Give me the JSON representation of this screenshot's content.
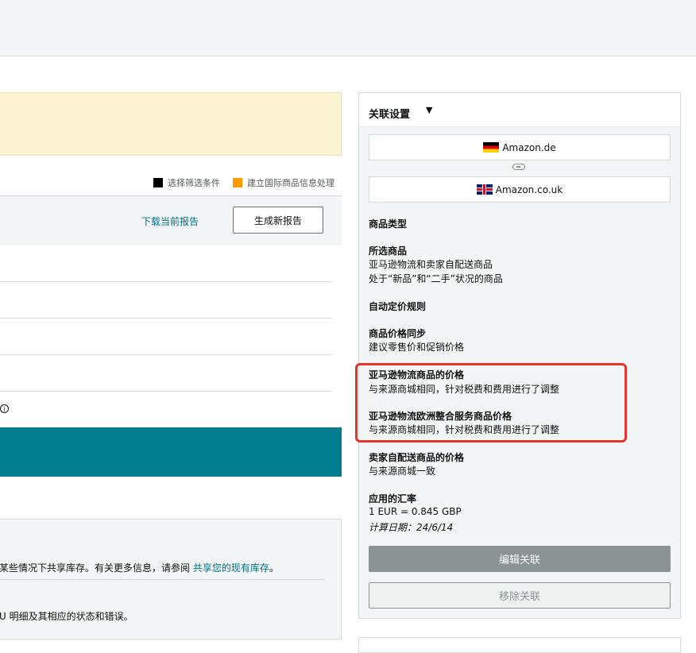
{
  "legend": {
    "item1": "选择筛选条件",
    "item1_color": "#000000",
    "item2": "建立国际商品信息处理",
    "item2_color": "#ff9900"
  },
  "report_toolbar": {
    "download_link": "下载当前报告",
    "generate_button": "生成新报告"
  },
  "bottom_panel": {
    "line1_text": "某些情况下共享库存。有关更多信息，请参阅 ",
    "line1_link": "共享您的现有库存",
    "line1_end": "。",
    "line2_text": "U 明细及其相应的状态和错误。"
  },
  "sidebar": {
    "title": "关联设置",
    "marketplaces": [
      {
        "name": "Amazon.de",
        "flag": "de"
      },
      {
        "name": "Amazon.co.uk",
        "flag": "uk"
      }
    ],
    "product_type_heading": "商品类型",
    "selected_products_heading": "所选商品",
    "selected_products_line1": "亚马逊物流和卖家自配送商品",
    "selected_products_line2": "处于“新品”和“二手”状况的商品",
    "auto_pricing_heading": "自动定价规则",
    "price_sync_heading": "商品价格同步",
    "price_sync_value": "建议零售价和促销价格",
    "fba_price_heading": "亚马逊物流商品的价格",
    "fba_price_value": "与来源商城相同，针对税费和费用进行了调整",
    "pan_eu_heading": "亚马逊物流欧洲整合服务商品价格",
    "pan_eu_value": "与来源商城相同，针对税费和费用进行了调整",
    "mfn_price_heading": "卖家自配送商品的价格",
    "mfn_price_value": "与来源商城一致",
    "fx_heading": "应用的汇率",
    "fx_value": "1 EUR = 0.845 GBP",
    "fx_date": "计算日期：24/6/14",
    "edit_button": "编辑关联",
    "remove_button": "移除关联"
  },
  "colors": {
    "teal_band": "#007e8f",
    "highlight": "#e4342d",
    "link": "#007185"
  }
}
